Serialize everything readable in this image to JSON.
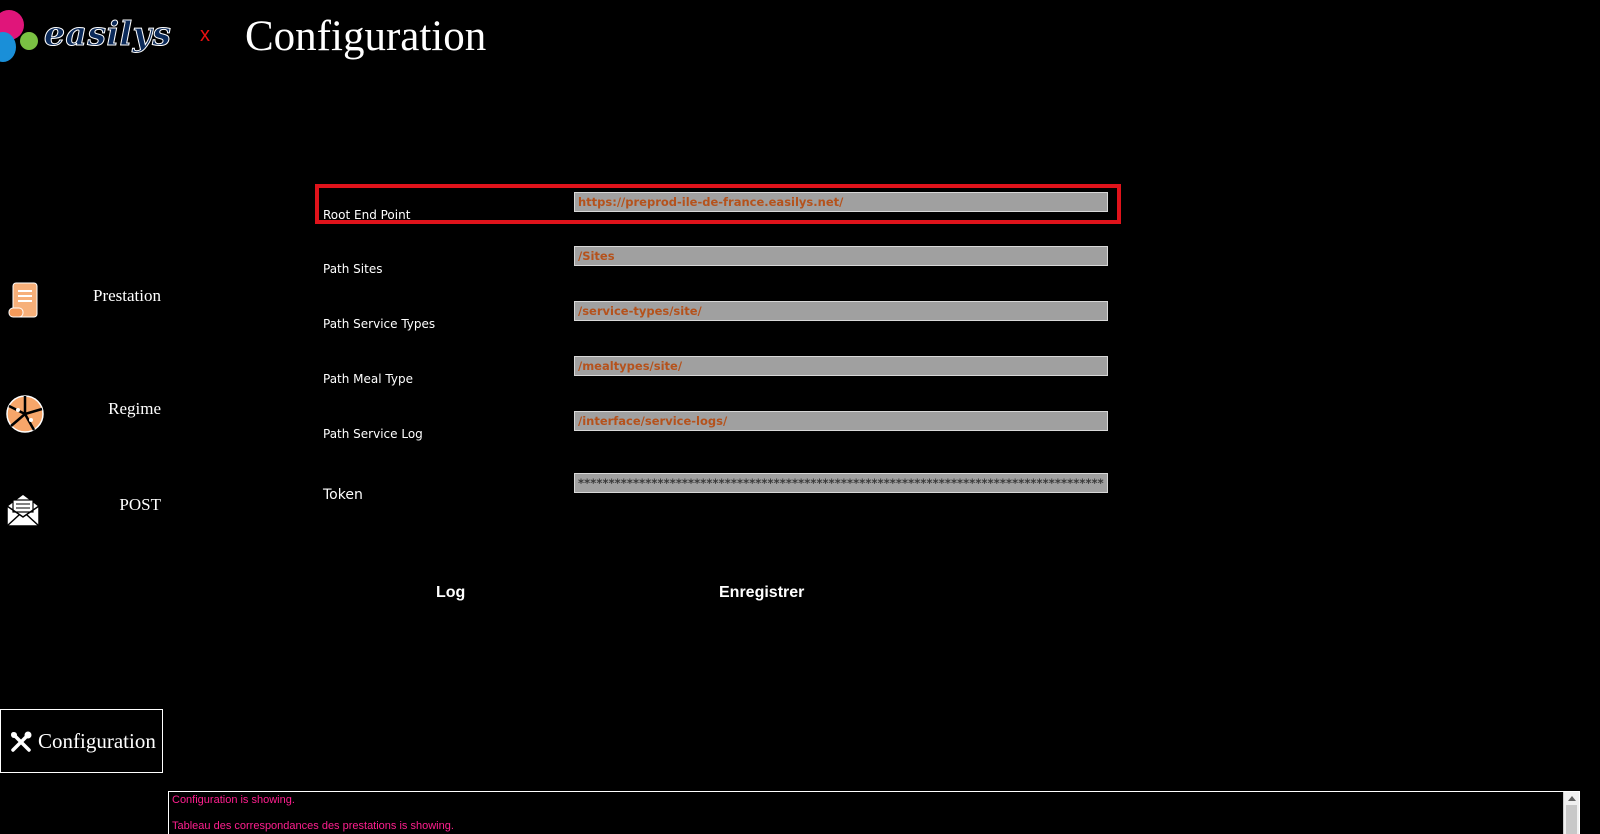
{
  "app": {
    "logo_text": "easilys",
    "close_label": "x",
    "title": "Configuration"
  },
  "sidebar": {
    "items": [
      {
        "label": "Prestation",
        "icon": "scroll-icon"
      },
      {
        "label": "Regime",
        "icon": "pie-icon"
      },
      {
        "label": "POST",
        "icon": "envelope-icon"
      }
    ],
    "active": {
      "label": "Configuration",
      "icon": "tools-icon"
    }
  },
  "form": {
    "fields": [
      {
        "label": "Root End Point",
        "value": "https://preprod-ile-de-france.easilys.net/"
      },
      {
        "label": "Path Sites",
        "value": "/Sites"
      },
      {
        "label": "Path Service Types",
        "value": "/service-types/site/"
      },
      {
        "label": "Path Meal Type",
        "value": "/mealtypes/site/"
      },
      {
        "label": "Path Service Log",
        "value": "/interface/service-logs/"
      },
      {
        "label": "Token",
        "value": "****************************************************************************************"
      }
    ],
    "highlight_color": "#e0131b",
    "value_color": "#b5521c"
  },
  "actions": {
    "log_label": "Log",
    "save_label": "Enregistrer"
  },
  "log": {
    "lines": [
      "Configuration is showing.",
      "Tableau des correspondances des prestations is showing."
    ],
    "color": "#ff1f8f"
  }
}
